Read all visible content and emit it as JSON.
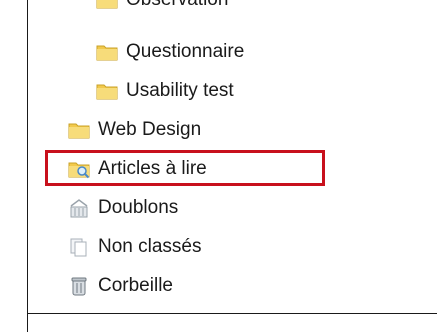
{
  "tree": {
    "items": [
      {
        "label": "Observation",
        "icon": "folder-icon"
      },
      {
        "label": "Questionnaire",
        "icon": "folder-icon"
      },
      {
        "label": "Usability test",
        "icon": "folder-icon"
      },
      {
        "label": "Web Design",
        "icon": "folder-icon"
      },
      {
        "label": "Articles à lire",
        "icon": "search-folder-icon"
      },
      {
        "label": "Doublons",
        "icon": "duplicates-icon"
      },
      {
        "label": "Non classés",
        "icon": "unfiled-icon"
      },
      {
        "label": "Corbeille",
        "icon": "trash-icon"
      }
    ]
  },
  "highlight_color": "#c8101c"
}
